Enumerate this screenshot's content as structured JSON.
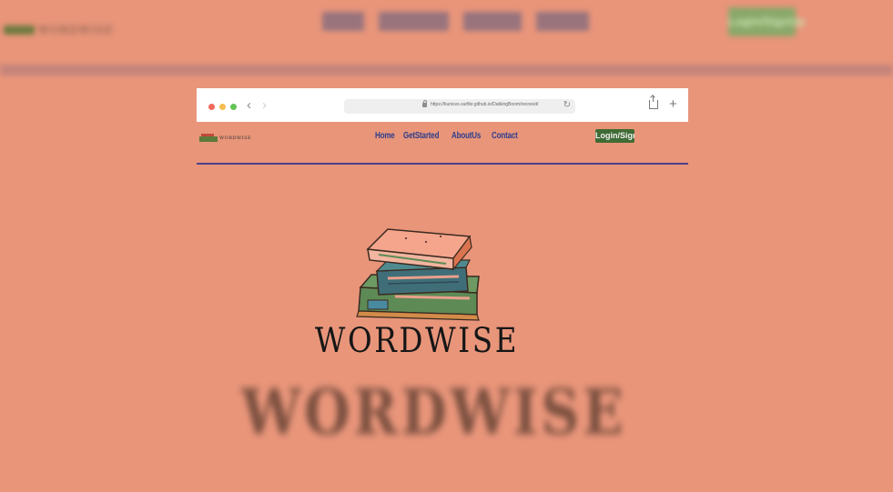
{
  "background_nav": {
    "links": [
      "Home",
      "GetStarted",
      "AboutUs",
      "Contact"
    ],
    "login_label": "Login/SignUp"
  },
  "browser": {
    "url": "https://kunisvs.surfikr.github.io/DatkingBoom/recnesit/",
    "controls": [
      "back-icon",
      "forward-icon",
      "reload-icon",
      "share-icon",
      "new-tab-icon"
    ]
  },
  "site": {
    "logo_text": "WORDWISE",
    "nav": [
      "Home",
      "GetStarted",
      "AboutUs",
      "Contact"
    ],
    "login_label": "Login/SignUp"
  },
  "hero": {
    "title": "WORDWISE",
    "blurred_title": "WORDWISE"
  },
  "colors": {
    "background": "#e8957a",
    "nav_link": "#2e3e8c",
    "nav_rule": "#4c3f8a",
    "login_button": "#3f6b34"
  }
}
